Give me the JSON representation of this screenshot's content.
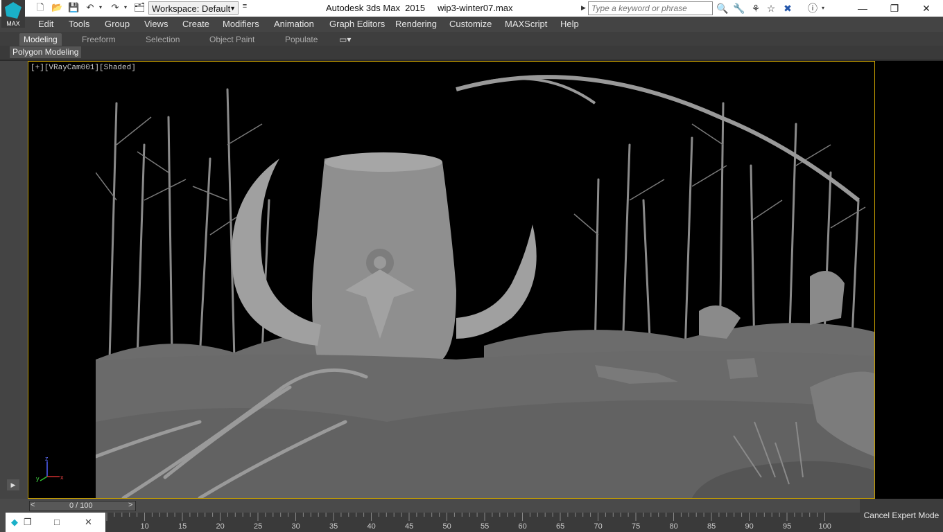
{
  "app": {
    "logo_text": "MAX",
    "title": "Autodesk 3ds Max  2015     wip3-winter07.max",
    "workspace_label": "Workspace: Default",
    "search_placeholder": "Type a keyword or phrase"
  },
  "menu": [
    "Edit",
    "Tools",
    "Group",
    "Views",
    "Create",
    "Modifiers",
    "Animation",
    "Graph Editors",
    "Rendering",
    "Customize",
    "MAXScript",
    "Help"
  ],
  "ribbon": {
    "tabs": [
      "Modeling",
      "Freeform",
      "Selection",
      "Object Paint",
      "Populate"
    ],
    "active_tab": "Modeling",
    "panel_label": "Polygon Modeling"
  },
  "viewport": {
    "label": "[+][VRayCam001][Shaded]",
    "axis_labels": {
      "z": "z",
      "y": "y",
      "x": "x"
    },
    "border_color": "#c8a000"
  },
  "timeline": {
    "frame_display": "0 / 100",
    "prev_label": "<",
    "next_label": ">",
    "tick_labels": [
      "10",
      "15",
      "20",
      "25",
      "30",
      "35",
      "40",
      "45",
      "50",
      "55",
      "60",
      "65",
      "70",
      "75",
      "80",
      "85",
      "90",
      "95",
      "100"
    ]
  },
  "status": {
    "cancel_expert_label": "Cancel Expert Mode"
  },
  "icons": [
    "new-file-icon",
    "open-file-icon",
    "save-icon",
    "undo-icon",
    "redo-icon",
    "project-folder-icon",
    "binoculars-icon",
    "tools-icon",
    "favorites-icon",
    "star-icon",
    "x-close-icon",
    "help-icon",
    "minimize-icon",
    "restore-icon",
    "close-icon",
    "play-icon"
  ]
}
